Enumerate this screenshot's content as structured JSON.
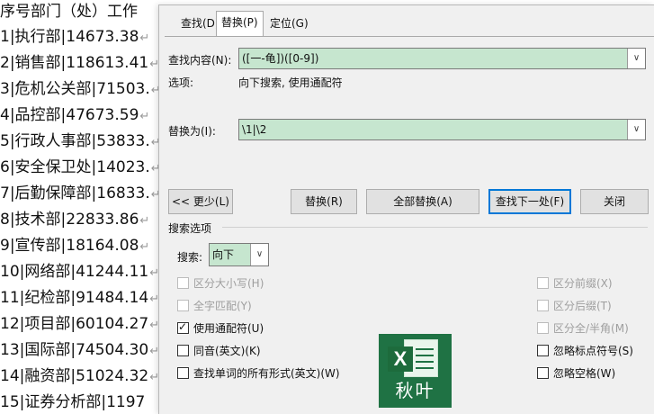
{
  "document": {
    "lines": [
      "序号部门（处）工作",
      "1|执行部|14673.38",
      "2|销售部|118613.41",
      "3|危机公关部|71503.",
      "4|品控部|47673.59",
      "5|行政人事部|53833.",
      "6|安全保卫处|14023.",
      "7|后勤保障部|16833.",
      "8|技术部|22833.86",
      "9|宣传部|18164.08",
      "10|网络部|41244.11",
      "11|纪检部|91484.14",
      "12|项目部|60104.27",
      "13|国际部|74504.30",
      "14|融资部|51024.32",
      "15|证券分析部|1197"
    ],
    "paragraph_mark": "↵"
  },
  "dialog": {
    "tabs": [
      "查找(D)",
      "替换(P)",
      "定位(G)"
    ],
    "active_tab": 1,
    "find_label": "查找内容(N):",
    "find_value": "([一-龟])([0-9])",
    "options_label": "选项:",
    "options_value": "向下搜索, 使用通配符",
    "replace_label": "替换为(I):",
    "replace_value": "\\1|\\2",
    "dropdown_arrow": "∨",
    "buttons": {
      "less": "<< 更少(L)",
      "replace": "替换(R)",
      "replace_all": "全部替换(A)",
      "find_next": "查找下一处(F)",
      "close": "关闭"
    },
    "search_options_title": "搜索选项",
    "search_label": "搜索:",
    "search_value": "向下",
    "checks_left": [
      {
        "label": "区分大小写(H)",
        "checked": false,
        "disabled": true
      },
      {
        "label": "全字匹配(Y)",
        "checked": false,
        "disabled": true
      },
      {
        "label": "使用通配符(U)",
        "checked": true,
        "disabled": false
      },
      {
        "label": "同音(英文)(K)",
        "checked": false,
        "disabled": false
      },
      {
        "label": "查找单词的所有形式(英文)(W)",
        "checked": false,
        "disabled": false
      }
    ],
    "checks_right": [
      {
        "label": "区分前缀(X)",
        "checked": false,
        "disabled": true
      },
      {
        "label": "区分后缀(T)",
        "checked": false,
        "disabled": true
      },
      {
        "label": "区分全/半角(M)",
        "checked": false,
        "disabled": true
      },
      {
        "label": "忽略标点符号(S)",
        "checked": false,
        "disabled": false
      },
      {
        "label": "忽略空格(W)",
        "checked": false,
        "disabled": false
      }
    ],
    "check_mark": "✓"
  },
  "watermark": {
    "letter": "X",
    "text": "秋叶",
    "color": "#1f7244"
  }
}
